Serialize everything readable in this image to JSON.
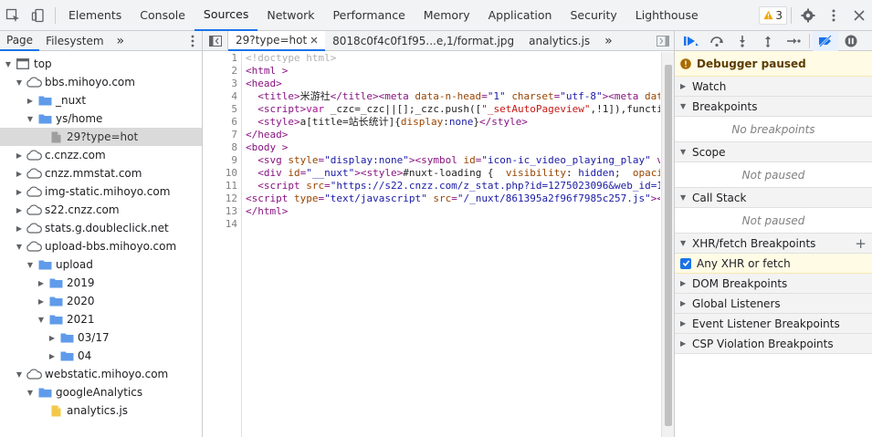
{
  "topbar": {
    "tabs": [
      "Elements",
      "Console",
      "Sources",
      "Network",
      "Performance",
      "Memory",
      "Application",
      "Security",
      "Lighthouse"
    ],
    "active_tab": "Sources",
    "warning_count": "3"
  },
  "navigator": {
    "tabs": [
      "Page",
      "Filesystem"
    ],
    "more": "»",
    "tree": [
      {
        "label": "top",
        "depth": 0,
        "icon": "frame",
        "open": true
      },
      {
        "label": "bbs.mihoyo.com",
        "depth": 1,
        "icon": "cloud",
        "open": true
      },
      {
        "label": "_nuxt",
        "depth": 2,
        "icon": "folder",
        "open": false
      },
      {
        "label": "ys/home",
        "depth": 2,
        "icon": "folder",
        "open": true
      },
      {
        "label": "29?type=hot",
        "depth": 3,
        "icon": "file",
        "selected": true
      },
      {
        "label": "c.cnzz.com",
        "depth": 1,
        "icon": "cloud",
        "open": false
      },
      {
        "label": "cnzz.mmstat.com",
        "depth": 1,
        "icon": "cloud",
        "open": false
      },
      {
        "label": "img-static.mihoyo.com",
        "depth": 1,
        "icon": "cloud",
        "open": false
      },
      {
        "label": "s22.cnzz.com",
        "depth": 1,
        "icon": "cloud",
        "open": false
      },
      {
        "label": "stats.g.doubleclick.net",
        "depth": 1,
        "icon": "cloud",
        "open": false
      },
      {
        "label": "upload-bbs.mihoyo.com",
        "depth": 1,
        "icon": "cloud",
        "open": true
      },
      {
        "label": "upload",
        "depth": 2,
        "icon": "folder",
        "open": true
      },
      {
        "label": "2019",
        "depth": 3,
        "icon": "folder",
        "open": false
      },
      {
        "label": "2020",
        "depth": 3,
        "icon": "folder",
        "open": false
      },
      {
        "label": "2021",
        "depth": 3,
        "icon": "folder",
        "open": true
      },
      {
        "label": "03/17",
        "depth": 4,
        "icon": "folder",
        "open": false
      },
      {
        "label": "04",
        "depth": 4,
        "icon": "folder",
        "open": false
      },
      {
        "label": "webstatic.mihoyo.com",
        "depth": 1,
        "icon": "cloud",
        "open": true
      },
      {
        "label": "googleAnalytics",
        "depth": 2,
        "icon": "folder",
        "open": true
      },
      {
        "label": "analytics.js",
        "depth": 3,
        "icon": "jsfile"
      }
    ]
  },
  "editor": {
    "tabs": [
      {
        "label": "29?type=hot",
        "closable": true,
        "active": true
      },
      {
        "label": "8018c0f4c0f1f95...e,1/format.jpg",
        "closable": false,
        "active": false
      },
      {
        "label": "analytics.js",
        "closable": false,
        "active": false
      }
    ],
    "more": "»",
    "line_numbers": [
      "1",
      "2",
      "3",
      "4",
      "5",
      "6",
      "7",
      "8",
      "9",
      "10",
      "11",
      "12",
      "13",
      "14"
    ],
    "lines": [
      [
        {
          "c": "c",
          "t": "<!doctype html>"
        }
      ],
      [
        {
          "c": "t",
          "t": "<html "
        },
        {
          "c": "t",
          "t": ">"
        }
      ],
      [
        {
          "c": "t",
          "t": "<head>"
        }
      ],
      [
        {
          "c": "p",
          "t": "  "
        },
        {
          "c": "t",
          "t": "<title>"
        },
        {
          "c": "p",
          "t": "米游社"
        },
        {
          "c": "t",
          "t": "</title><meta "
        },
        {
          "c": "a",
          "t": "data-n-head"
        },
        {
          "c": "t",
          "t": "="
        },
        {
          "c": "v",
          "t": "\"1\""
        },
        {
          "c": "t",
          "t": " "
        },
        {
          "c": "a",
          "t": "charset"
        },
        {
          "c": "t",
          "t": "="
        },
        {
          "c": "v",
          "t": "\"utf-8\""
        },
        {
          "c": "t",
          "t": "><meta "
        },
        {
          "c": "a",
          "t": "data-n-head"
        }
      ],
      [
        {
          "c": "p",
          "t": "  "
        },
        {
          "c": "t",
          "t": "<script>"
        },
        {
          "c": "k",
          "t": "var"
        },
        {
          "c": "p",
          "t": " _czc=_czc||[];_czc.push(["
        },
        {
          "c": "s",
          "t": "\"_setAutoPageview\""
        },
        {
          "c": "p",
          "t": ",!1]),functi"
        }
      ],
      [
        {
          "c": "p",
          "t": "  "
        },
        {
          "c": "t",
          "t": "<style>"
        },
        {
          "c": "p",
          "t": "a[title=站长统计]{"
        },
        {
          "c": "a",
          "t": "display"
        },
        {
          "c": "p",
          "t": ":"
        },
        {
          "c": "v",
          "t": "none"
        },
        {
          "c": "p",
          "t": "}"
        },
        {
          "c": "t",
          "t": "</style>"
        }
      ],
      [
        {
          "c": "t",
          "t": "</head>"
        }
      ],
      [
        {
          "c": "t",
          "t": "<body >"
        }
      ],
      [
        {
          "c": "p",
          "t": "  "
        },
        {
          "c": "t",
          "t": "<svg "
        },
        {
          "c": "a",
          "t": "style"
        },
        {
          "c": "t",
          "t": "="
        },
        {
          "c": "v",
          "t": "\"display:none\""
        },
        {
          "c": "t",
          "t": "><symbol "
        },
        {
          "c": "a",
          "t": "id"
        },
        {
          "c": "t",
          "t": "="
        },
        {
          "c": "v",
          "t": "\"icon-ic_video_playing_play\""
        },
        {
          "c": "t",
          "t": " v"
        }
      ],
      [
        {
          "c": "p",
          "t": "  "
        },
        {
          "c": "t",
          "t": "<div "
        },
        {
          "c": "a",
          "t": "id"
        },
        {
          "c": "t",
          "t": "="
        },
        {
          "c": "v",
          "t": "\"__nuxt\""
        },
        {
          "c": "t",
          "t": "><style>"
        },
        {
          "c": "p",
          "t": "#nuxt-loading {  "
        },
        {
          "c": "a",
          "t": "visibility"
        },
        {
          "c": "p",
          "t": ": "
        },
        {
          "c": "v",
          "t": "hidden"
        },
        {
          "c": "p",
          "t": ";  "
        },
        {
          "c": "a",
          "t": "opaci"
        }
      ],
      [
        {
          "c": "p",
          "t": "  "
        },
        {
          "c": "t",
          "t": "<script "
        },
        {
          "c": "a",
          "t": "src"
        },
        {
          "c": "t",
          "t": "="
        },
        {
          "c": "v",
          "t": "\"https://s22.cnzz.com/z_stat.php?id=1275023096&web_id=1"
        }
      ],
      [
        {
          "c": "t",
          "t": "<script "
        },
        {
          "c": "a",
          "t": "type"
        },
        {
          "c": "t",
          "t": "="
        },
        {
          "c": "v",
          "t": "\"text/javascript\""
        },
        {
          "c": "t",
          "t": " "
        },
        {
          "c": "a",
          "t": "src"
        },
        {
          "c": "t",
          "t": "="
        },
        {
          "c": "v",
          "t": "\"/_nuxt/861395a2f96f7985c257.js\""
        },
        {
          "c": "t",
          "t": "><"
        }
      ],
      [
        {
          "c": "t",
          "t": "</html>"
        }
      ],
      []
    ]
  },
  "debugger": {
    "paused_label": "Debugger paused",
    "sections": {
      "watch": "Watch",
      "breakpoints": "Breakpoints",
      "breakpoints_empty": "No breakpoints",
      "scope": "Scope",
      "scope_empty": "Not paused",
      "call_stack": "Call Stack",
      "call_stack_empty": "Not paused",
      "xhr": "XHR/fetch Breakpoints",
      "xhr_item": "Any XHR or fetch",
      "dom": "DOM Breakpoints",
      "global": "Global Listeners",
      "event": "Event Listener Breakpoints",
      "csp": "CSP Violation Breakpoints"
    }
  },
  "colors": {
    "accent": "#1a73e8",
    "paused_bg": "#fffbe5",
    "folder": "#5f9bea",
    "file_js": "#f3c84a"
  }
}
